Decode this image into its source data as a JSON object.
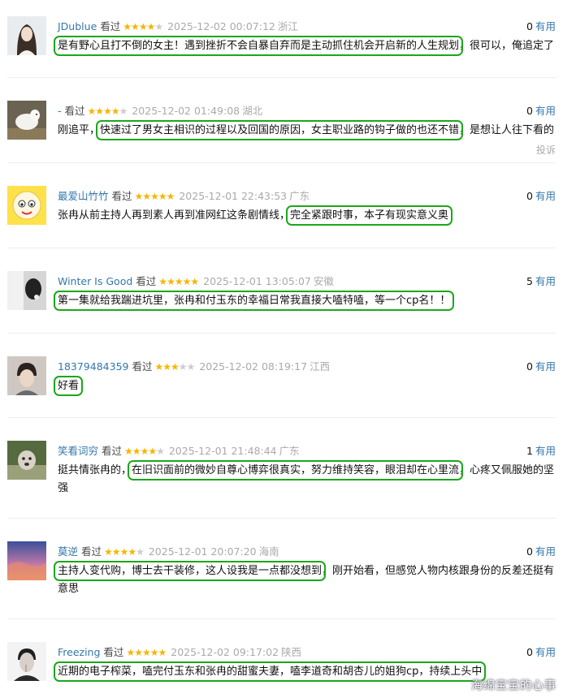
{
  "useful_label": "有用",
  "watched_label": "看过",
  "report_label": "投诉",
  "watermark": "海绵宝宝的心事",
  "colors": {
    "link": "#3377aa",
    "star": "#f7b500",
    "highlight": "#1aa81a",
    "meta": "#aaaaaa"
  },
  "comments": [
    {
      "user": "JDublue",
      "rating": 4,
      "time": "2025-12-02 00:07:12",
      "location": "浙江",
      "useful": "0",
      "pre": "",
      "hl": "是有野心且打不倒的女主！遇到挫折不会自暴自弃而是主动抓住机会开启新的人生规划",
      "post": "，很可以，俺追定了",
      "avatar": "woman-portrait"
    },
    {
      "user": "-",
      "rating": 4,
      "time": "2025-12-02 01:49:08",
      "location": "湖北",
      "useful": "0",
      "pre": "刚追平，",
      "hl": "快速过了男女主相识的过程以及回国的原因，女主职业路的钩子做的也还不错",
      "post": "，是想让人往下看的",
      "avatar": "sheep"
    },
    {
      "user": "最爱山竹竹",
      "rating": 5,
      "time": "2025-12-01 22:43:53",
      "location": "广东",
      "useful": "0",
      "pre": "张冉从前主持人再到素人再到准网红这条剧情线，",
      "hl": "完全紧跟时事，本子有现实意义奥",
      "post": "",
      "avatar": "cartoon-sheep"
    },
    {
      "user": "Winter Is Good",
      "rating": 5,
      "time": "2025-12-01 13:05:07",
      "location": "安徽",
      "useful": "5",
      "pre": "",
      "hl": "第一集就给我踹进坑里，张冉和付玉东的幸福日常我直接大嗑特嗑，等一个cp名！！",
      "post": "",
      "avatar": "dark-art"
    },
    {
      "user": "18379484359",
      "rating": 3,
      "time": "2025-12-02 08:19:17",
      "location": "江西",
      "useful": "0",
      "pre": "",
      "hl": "好看",
      "post": "",
      "avatar": "boy-portrait"
    },
    {
      "user": "笑看词穷",
      "rating": 4,
      "time": "2025-12-01 21:48:44",
      "location": "广东",
      "useful": "1",
      "pre": "挺共情张冉的，",
      "hl": "在旧识面前的微妙自尊心博弈很真实，努力维持笑容，眼泪却在心里流",
      "post": "，心疼又佩服她的坚强",
      "avatar": "dog"
    },
    {
      "user": "莫逆",
      "rating": 4,
      "time": "2025-12-01 20:07:20",
      "location": "海南",
      "useful": "0",
      "pre": "",
      "hl": "主持人变代购，博士去干装修，这人设我是一点都没想到",
      "post": "，刚开始看，但感觉人物内核跟身份的反差还挺有意思",
      "avatar": "sunset-sky"
    },
    {
      "user": "Freezing",
      "rating": 5,
      "time": "2025-12-02 09:17:02",
      "location": "陕西",
      "useful": "0",
      "pre": "",
      "hl": "近期的电子榨菜，嗑完付玉东和张冉的甜蜜夫妻，嗑李道奇和胡杏儿的姐狗cp，持续上头中",
      "post": "",
      "avatar": "man-portrait"
    }
  ]
}
